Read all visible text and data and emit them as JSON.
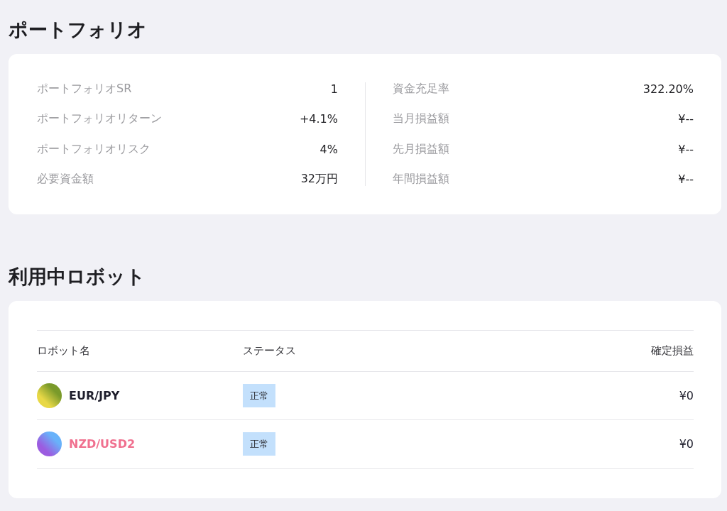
{
  "portfolio": {
    "title": "ポートフォリオ",
    "left": [
      {
        "label": "ポートフォリオSR",
        "value": "1"
      },
      {
        "label": "ポートフォリオリターン",
        "value": "+4.1%"
      },
      {
        "label": "ポートフォリオリスク",
        "value": "4%"
      },
      {
        "label": "必要資金額",
        "value": "32万円"
      }
    ],
    "right": [
      {
        "label": "資金充足率",
        "value": "322.20%"
      },
      {
        "label": "当月損益額",
        "value": "¥--"
      },
      {
        "label": "先月損益額",
        "value": "¥--"
      },
      {
        "label": "年間損益額",
        "value": "¥--"
      }
    ]
  },
  "robots": {
    "title": "利用中ロボット",
    "columns": [
      "ロボット名",
      "ステータス",
      "確定損益"
    ],
    "rows": [
      {
        "name": "EUR/JPY",
        "color": "#1e1e2c",
        "avatar_gradient": [
          {
            "color": "#7a9a2a"
          },
          {
            "color": "#e8d846"
          }
        ],
        "status": "正常",
        "profit": "¥0"
      },
      {
        "name": "NZD/USD2",
        "color": "#f0708f",
        "avatar_gradient": [
          {
            "color": "#68b2fa"
          },
          {
            "color": "#9b5ce0"
          }
        ],
        "status": "正常",
        "profit": "¥0"
      }
    ]
  }
}
